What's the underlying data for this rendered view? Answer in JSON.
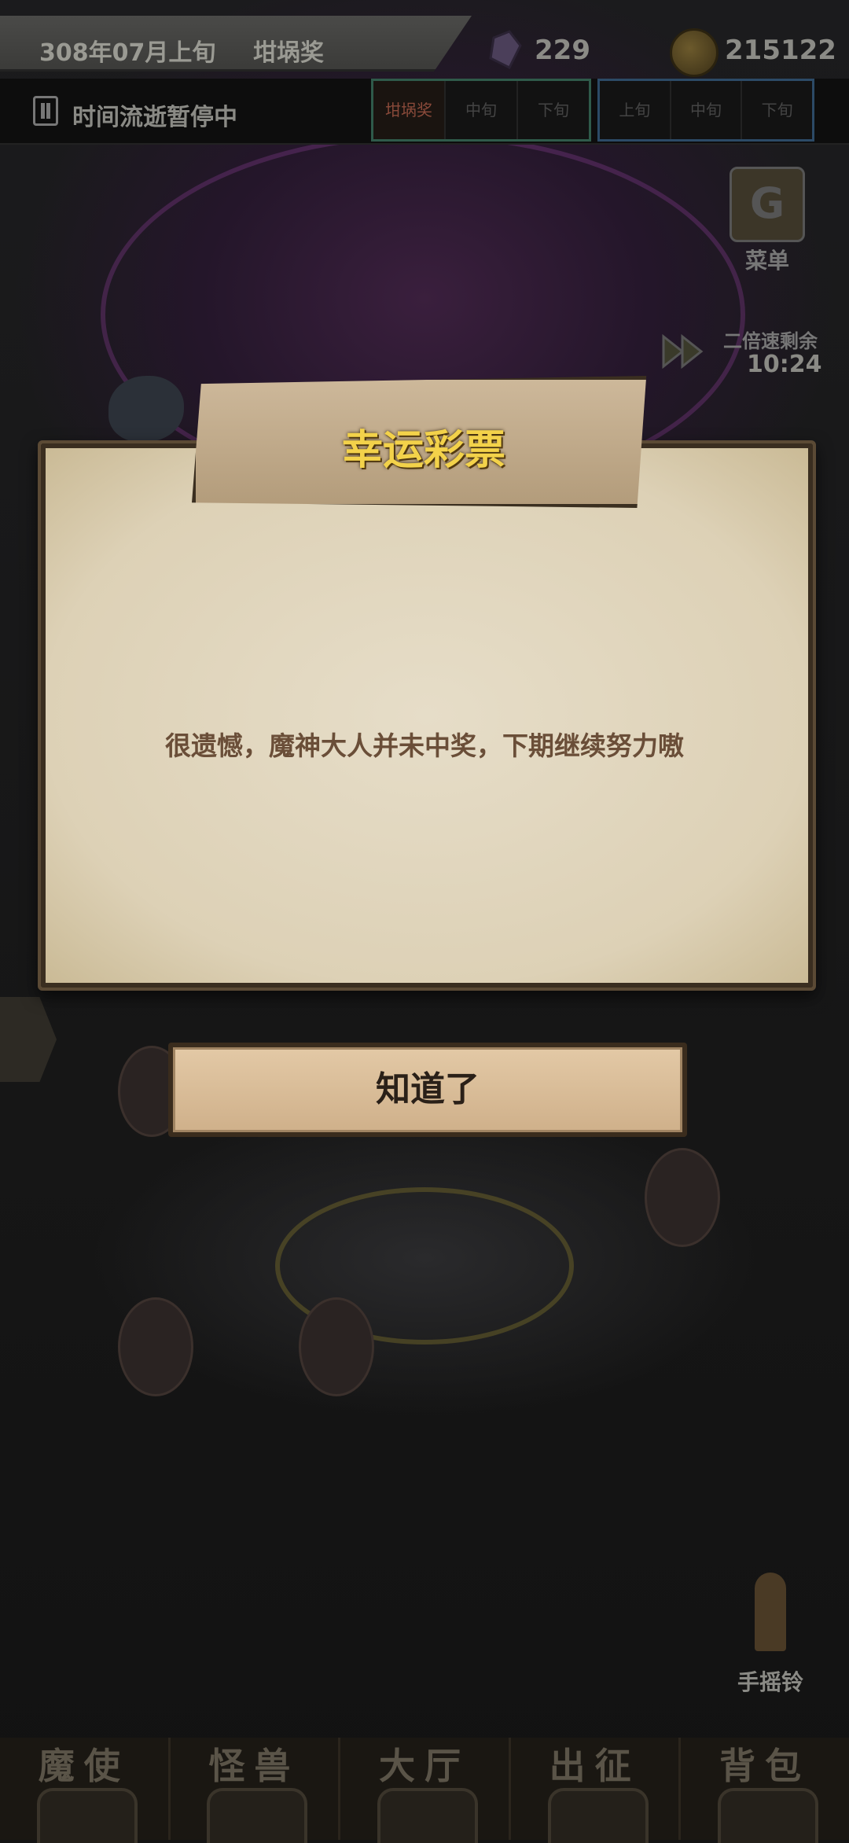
{
  "header": {
    "date": "308年07月上旬",
    "prize_label": "坩埚奖",
    "gem_count": "229",
    "gold_count": "215122"
  },
  "timebar": {
    "status": "时间流逝暂停中",
    "group1": [
      "坩埚奖",
      "中旬",
      "下旬"
    ],
    "group2": [
      "上旬",
      "中旬",
      "下旬"
    ]
  },
  "side": {
    "menu_label": "菜单",
    "speed_label": "二倍速剩余",
    "speed_time": "10:24",
    "bell_label": "手摇铃"
  },
  "dialog": {
    "title": "幸运彩票",
    "message": "很遗憾，魔神大人并未中奖，下期继续努力嗷",
    "ok_label": "知道了"
  },
  "bottom_nav": {
    "items": [
      {
        "label": "魔使",
        "icon": "skull-icon"
      },
      {
        "label": "怪兽",
        "icon": "monster-icon"
      },
      {
        "label": "大厅",
        "icon": "hall-icon"
      },
      {
        "label": "出征",
        "icon": "expedition-icon"
      },
      {
        "label": "背包",
        "icon": "backpack-icon"
      }
    ]
  },
  "colors": {
    "title_gold": "#f3d24a",
    "paper": "#e2d8c2",
    "message_brown": "#6a4e38"
  }
}
